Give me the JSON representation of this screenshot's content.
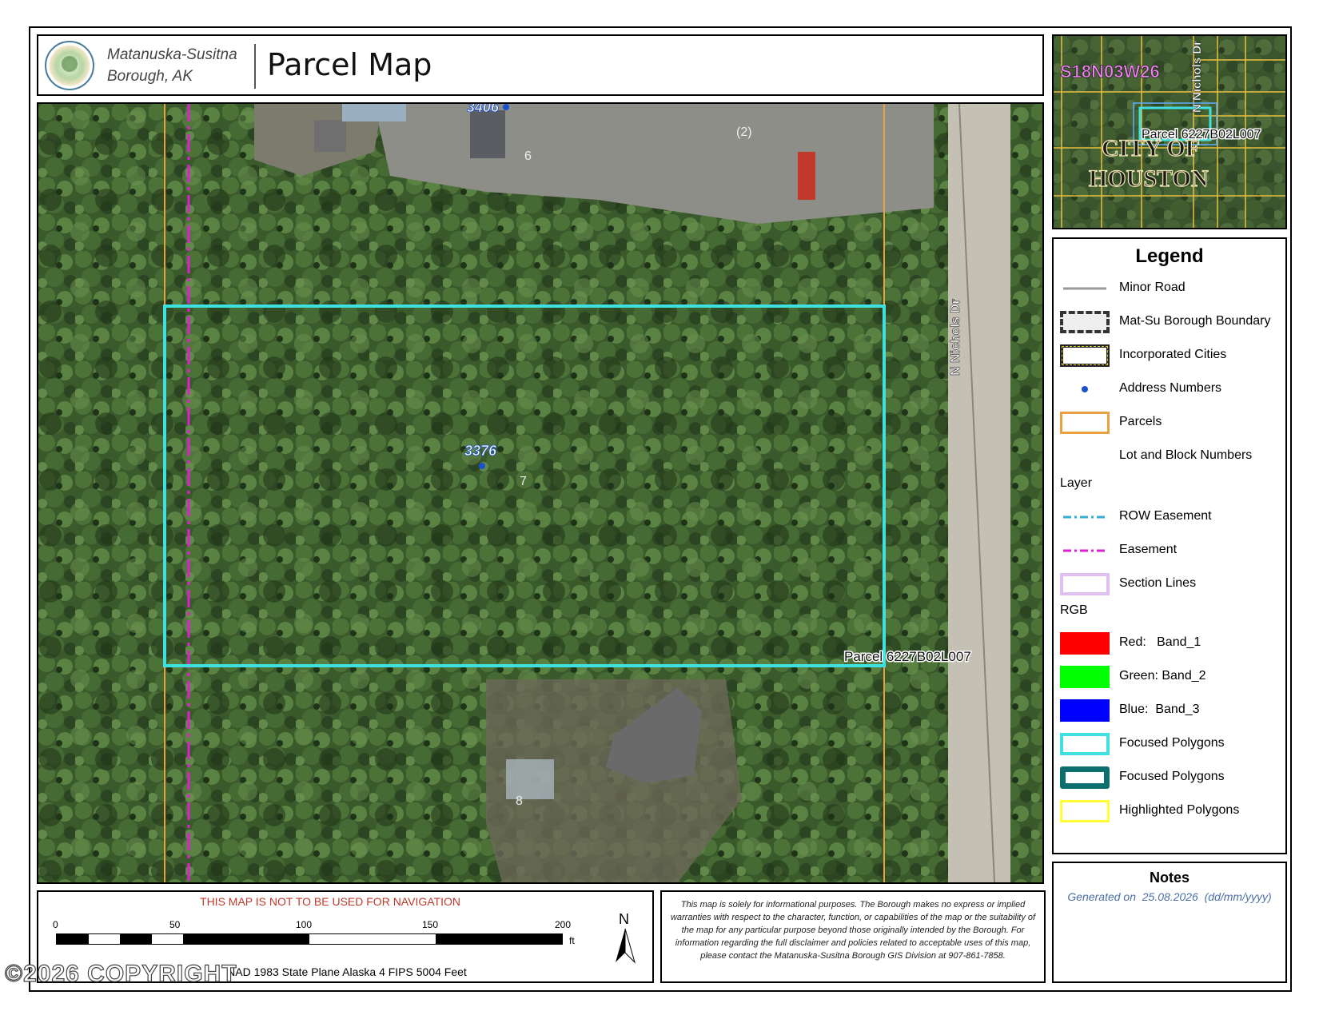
{
  "header": {
    "org_line1": "Matanuska-Susitna",
    "org_line2": "Borough, AK",
    "title": "Parcel Map"
  },
  "map": {
    "address_top": "3406",
    "address_main": "3376",
    "lot_top": "6",
    "block_label": "(2)",
    "lot_main": "7",
    "lot_bottom": "8",
    "road_label": "N Nichols Dr",
    "parcel_label": "Parcel 6227B02L007"
  },
  "inset": {
    "section_label": "S18N03W26",
    "road_label": "N Nichols Dr",
    "parcel_label": "Parcel 6227B02L007",
    "city_line1": "CITY OF",
    "city_line2": "HOUSTON"
  },
  "legend": {
    "title": "Legend",
    "items": [
      {
        "label": "Minor Road",
        "symbol": "minor-road-line"
      },
      {
        "label": "Mat-Su Borough Boundary",
        "symbol": "borough-boundary-box"
      },
      {
        "label": "Incorporated Cities",
        "symbol": "cities-box"
      },
      {
        "label": "Address Numbers",
        "symbol": "address-dot"
      },
      {
        "label": "Parcels",
        "symbol": "parcel-box"
      },
      {
        "label": "Lot and Block Numbers",
        "symbol": "none"
      },
      {
        "label": "ROW Easement",
        "symbol": "row-easement-line"
      },
      {
        "label": "Easement",
        "symbol": "easement-line"
      },
      {
        "label": "Section Lines",
        "symbol": "section-box"
      },
      {
        "label": "Red:   Band_1",
        "symbol": "red-swatch",
        "color": "#ff0000"
      },
      {
        "label": "Green: Band_2",
        "symbol": "green-swatch",
        "color": "#00ff00"
      },
      {
        "label": "Blue:  Band_3",
        "symbol": "blue-swatch",
        "color": "#0000ff"
      },
      {
        "label": "Focused Polygons",
        "symbol": "focused-cyan-box",
        "color": "#3fe0e0"
      },
      {
        "label": "Focused Polygons",
        "symbol": "focused-teal-box",
        "color": "#0d6e6e"
      },
      {
        "label": "Highlighted Polygons",
        "symbol": "highlight-yellow-box",
        "color": "#ffff33"
      }
    ],
    "layer_heading": "Layer",
    "rgb_heading": "RGB"
  },
  "notes": {
    "title": "Notes",
    "generated": "Generated on  25.08.2026  (dd/mm/yyyy)"
  },
  "scale": {
    "warning": "THIS MAP IS NOT TO BE USED FOR NAVIGATION",
    "ticks": [
      "0",
      "50",
      "100",
      "150",
      "200"
    ],
    "unit": "ft",
    "projection": "NAD 1983 State Plane Alaska 4 FIPS 5004 Feet",
    "north": "N"
  },
  "disclaimer": "This map is solely for informational purposes. The Borough makes no express or implied warranties with respect to the character, function, or capabilities of the map or the suitability of the map for any particular purpose beyond those originally intended by the Borough. For information regarding the full disclaimer and policies related to acceptable uses of this map, please contact the Matanuska-Susitna Borough GIS Division at 907-861-7858.",
  "watermark": "©2026 COPYRIGHT",
  "colors": {
    "focused": "#3fe0e0",
    "easement": "#e020d0",
    "parcel_line": "#e8a040",
    "address": "#1a4fd0",
    "warning": "#c0392b"
  }
}
